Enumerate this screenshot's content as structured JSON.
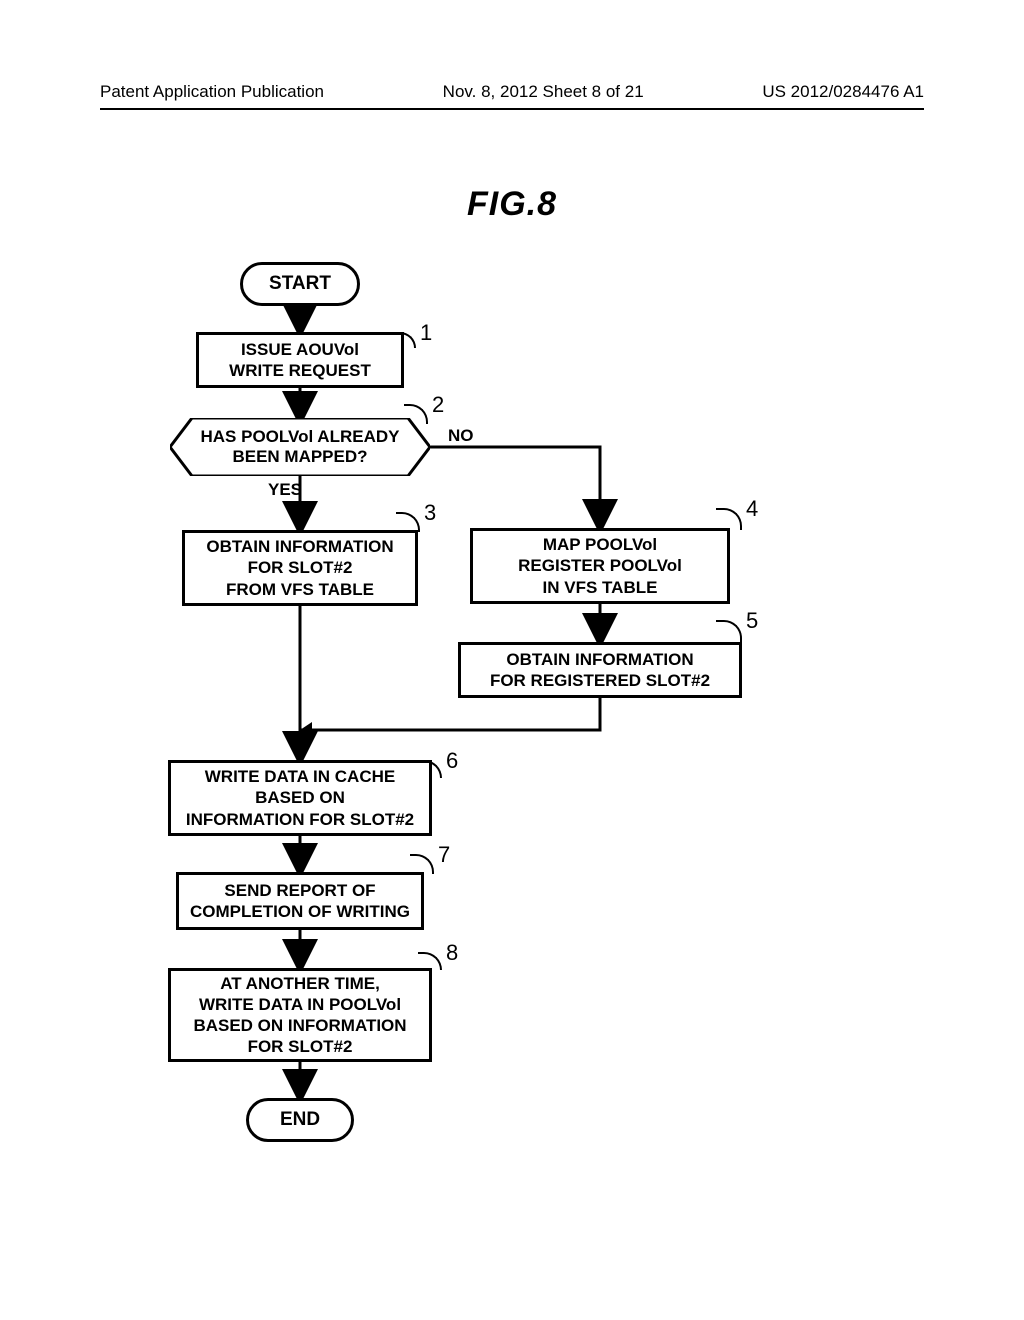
{
  "header": {
    "left": "Patent Application Publication",
    "center": "Nov. 8, 2012   Sheet 8 of 21",
    "right": "US 2012/0284476 A1"
  },
  "figure_title": "FIG.8",
  "nodes": {
    "start": "START",
    "end": "END",
    "step1": "ISSUE AOUVol\nWRITE REQUEST",
    "decision2": "HAS POOLVol ALREADY\nBEEN MAPPED?",
    "step3": "OBTAIN INFORMATION\nFOR SLOT#2\nFROM VFS TABLE",
    "step4": "MAP POOLVol\nREGISTER POOLVol\nIN VFS TABLE",
    "step5": "OBTAIN INFORMATION\nFOR REGISTERED SLOT#2",
    "step6": "WRITE DATA IN CACHE\nBASED ON\nINFORMATION FOR SLOT#2",
    "step7": "SEND REPORT OF\nCOMPLETION OF WRITING",
    "step8": "AT ANOTHER TIME,\nWRITE DATA IN POOLVol\nBASED ON INFORMATION\nFOR SLOT#2"
  },
  "branches": {
    "yes": "YES",
    "no": "NO"
  },
  "refs": {
    "r1": "1",
    "r2": "2",
    "r3": "3",
    "r4": "4",
    "r5": "5",
    "r6": "6",
    "r7": "7",
    "r8": "8"
  }
}
